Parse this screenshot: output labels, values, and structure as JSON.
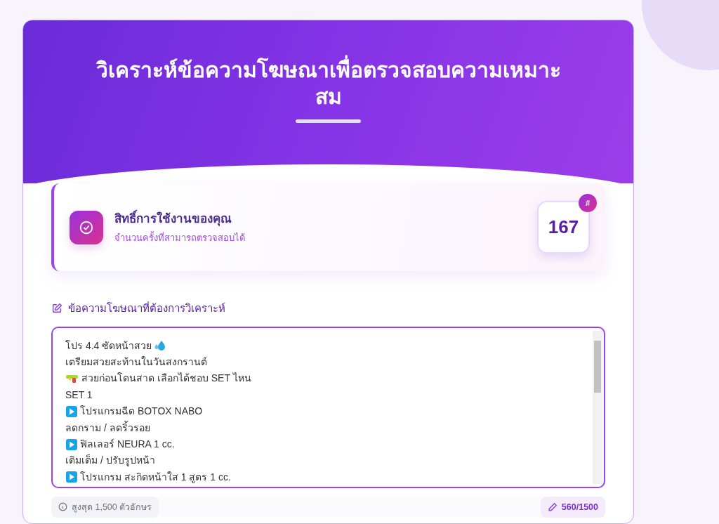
{
  "header": {
    "title": "วิเคราะห์ข้อความโฆษณาเพื่อตรวจสอบความเหมาะสม"
  },
  "quota": {
    "title": "สิทธิ์การใช้งานของคุณ",
    "subtitle": "จำนวนครั้งที่สามารถตรวจสอบได้",
    "count": "167",
    "badge": "#"
  },
  "ad_text": {
    "label": "ข้อความโฆษณาที่ต้องการวิเคราะห์",
    "lines": [
      {
        "kind": "drops",
        "text": "โปร 4.4 ซัดหน้าสวย"
      },
      {
        "kind": "plain",
        "text": "เตรียมสวยสะท้านในวันสงกรานต์"
      },
      {
        "kind": "water-gun",
        "text": "สวยก่อนโดนสาด เลือกได้ชอบ SET ไหน"
      },
      {
        "kind": "plain",
        "text": "SET 1"
      },
      {
        "kind": "play",
        "text": "โปรแกรมฉีด BOTOX NABO"
      },
      {
        "kind": "plain",
        "text": "ลดกราม /  ลดริ้วรอย"
      },
      {
        "kind": "play",
        "text": "ฟิลเลอร์ NEURA 1 cc."
      },
      {
        "kind": "plain",
        "text": "เติมเต็ม / ปรับรูปหน้า"
      },
      {
        "kind": "play",
        "text": "โปรแกรม สะกิดหน้าใส 1 สูตร 1 cc."
      }
    ],
    "limit": "สูงสุด 1,500 ตัวอักษร",
    "counter": "560/1500"
  }
}
